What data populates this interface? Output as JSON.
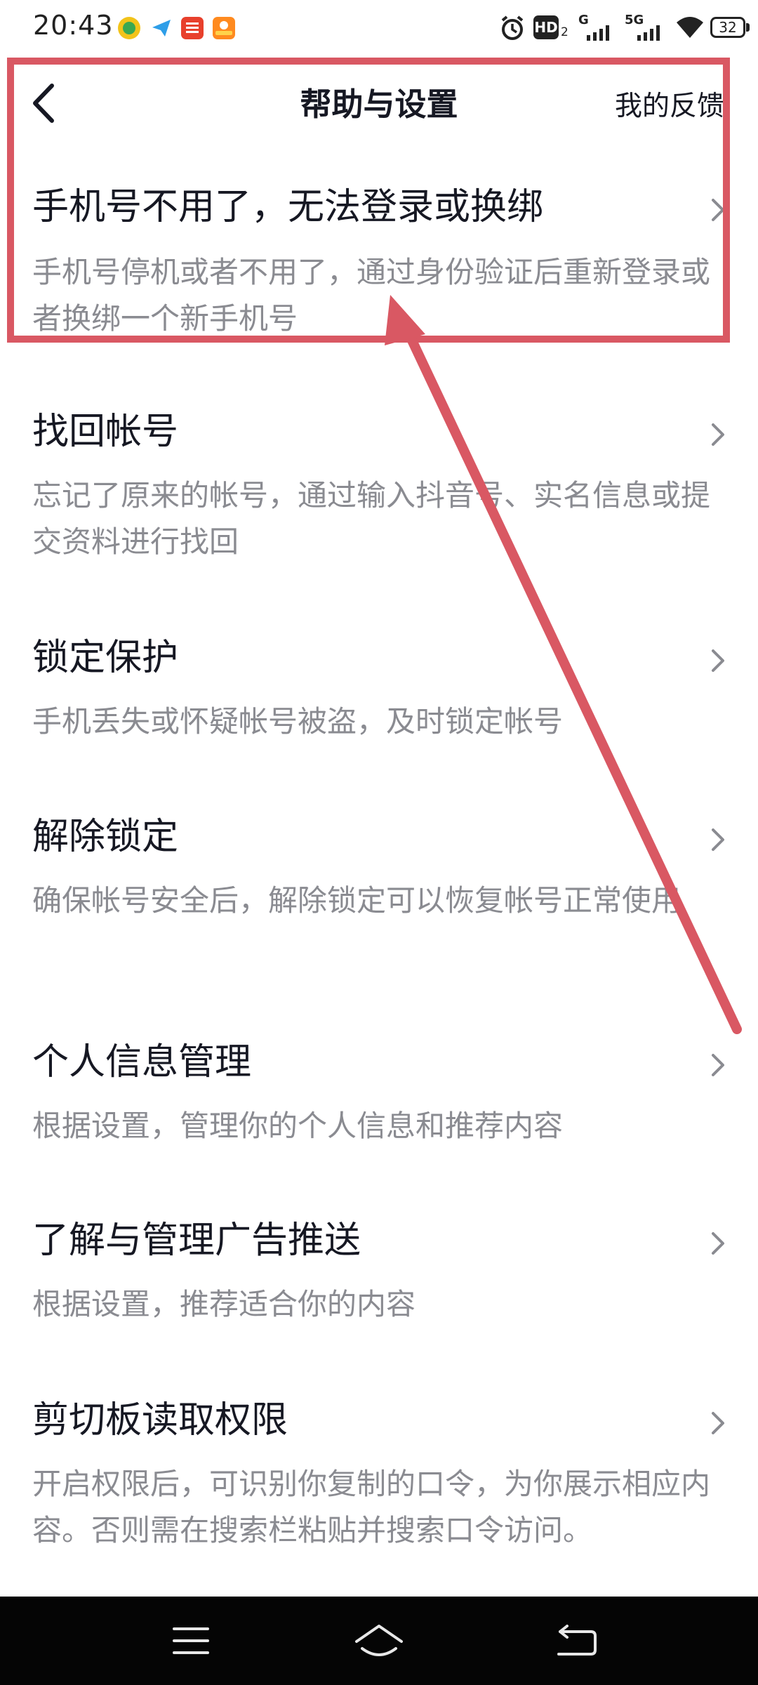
{
  "status_bar": {
    "time": "20:43",
    "network_1": "HD",
    "network_1_sub": "2",
    "network_2": "G",
    "network_3": "5G",
    "battery": "32"
  },
  "header": {
    "title": "帮助与设置",
    "feedback_label": "我的反馈"
  },
  "items": [
    {
      "title": "手机号不用了，无法登录或换绑",
      "desc": "手机号停机或者不用了，通过身份验证后重新登录或者换绑一个新手机号"
    },
    {
      "title": "找回帐号",
      "desc": "忘记了原来的帐号，通过输入抖音号、实名信息或提交资料进行找回"
    },
    {
      "title": "锁定保护",
      "desc": "手机丢失或怀疑帐号被盗，及时锁定帐号"
    },
    {
      "title": "解除锁定",
      "desc": "确保帐号安全后，解除锁定可以恢复帐号正常使用"
    },
    {
      "title": "个人信息管理",
      "desc": "根据设置，管理你的个人信息和推荐内容"
    },
    {
      "title": "了解与管理广告推送",
      "desc": "根据设置，推荐适合你的内容"
    },
    {
      "title": "剪切板读取权限",
      "desc": "开启权限后，可识别你复制的口令，为你展示相应内容。否则需在搜索栏粘贴并搜索口令访问。"
    }
  ],
  "annotation": {
    "color": "#d95863"
  },
  "nav_bar": {
    "icons": [
      "menu-icon",
      "home-icon",
      "back-icon"
    ]
  }
}
